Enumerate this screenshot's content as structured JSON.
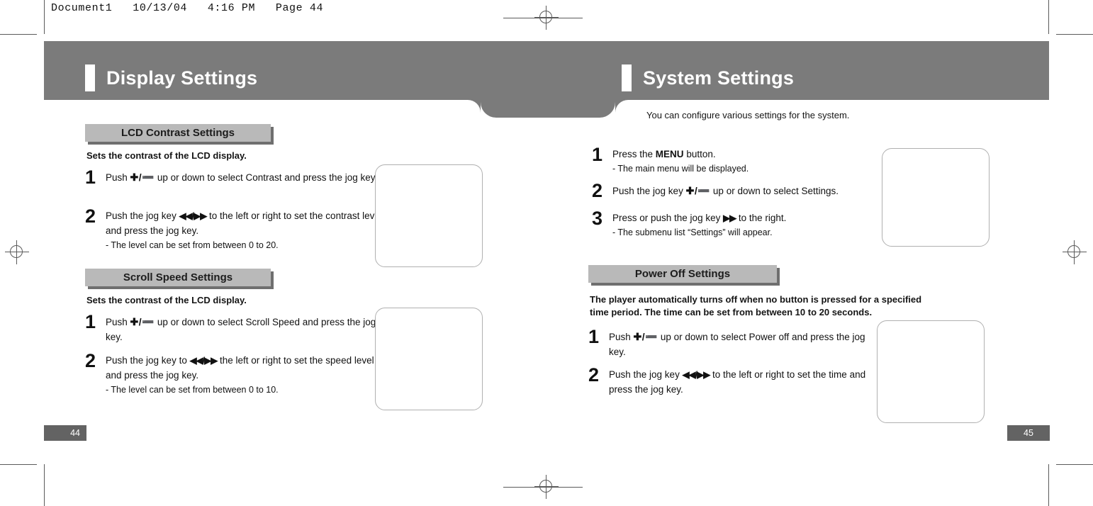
{
  "document_header": "Document1   10/13/04   4:16 PM   Page 44",
  "theme": {
    "banner_gray": "#7b7b7b",
    "chip_gray": "#b9b9b9",
    "chip_shadow": "#6f6f6f",
    "badge_gray": "#636363"
  },
  "left_page": {
    "banner_title": "Display Settings",
    "page_number": "44",
    "sections": [
      {
        "heading": "LCD Contrast Settings",
        "description": "Sets the contrast of the LCD display.",
        "steps": [
          {
            "number": "1",
            "text_before": "Push",
            "glyph": "✚/➖",
            "text_after": "up or down to select Contrast and press the jog key.",
            "note": ""
          },
          {
            "number": "2",
            "text_before": "Push the jog key",
            "glyph": "◀◀/▶▶",
            "text_after": "to the left or right to set the contrast level and press the jog key.",
            "note": "- The level can be set from between 0 to 20."
          }
        ]
      },
      {
        "heading": "Scroll Speed Settings",
        "description": "Sets the contrast of the LCD display.",
        "steps": [
          {
            "number": "1",
            "text_before": "Push",
            "glyph": "✚/➖",
            "text_after": "up or down to select Scroll Speed and press the jog key.",
            "note": ""
          },
          {
            "number": "2",
            "text_before": "Push the jog key to",
            "glyph": "◀◀/▶▶",
            "text_after": "the left or right to set the speed level and press the jog key.",
            "note": "- The level can be set from between 0 to 10."
          }
        ]
      }
    ]
  },
  "right_page": {
    "banner_title": "System Settings",
    "page_number": "45",
    "intro": "You can configure various settings for the system.",
    "top_steps": [
      {
        "number": "1",
        "text_before": "Press the",
        "bold_word": "MENU",
        "text_after": "button.",
        "note": "- The main menu will be displayed."
      },
      {
        "number": "2",
        "text_before": "Push the jog key",
        "glyph": "✚/➖",
        "text_after": "up or down to select Settings.",
        "note": ""
      },
      {
        "number": "3",
        "text_before": "Press or push the jog key",
        "glyph": "▶▶",
        "text_after": "to the right.",
        "note": "-  The submenu list “Settings” will appear."
      }
    ],
    "sections": [
      {
        "heading": "Power Off Settings",
        "description": "The player automatically turns off when no button is pressed for a specified time period. The time can be set from between 10 to 20 seconds.",
        "steps": [
          {
            "number": "1",
            "text_before": "Push",
            "glyph": "✚/➖",
            "text_after": "up or down to select Power off and press the jog key.",
            "note": ""
          },
          {
            "number": "2",
            "text_before": "Push the jog key",
            "glyph": "◀◀/▶▶",
            "text_after": "to the left or right to set the time and press the jog key.",
            "note": ""
          }
        ]
      }
    ]
  }
}
